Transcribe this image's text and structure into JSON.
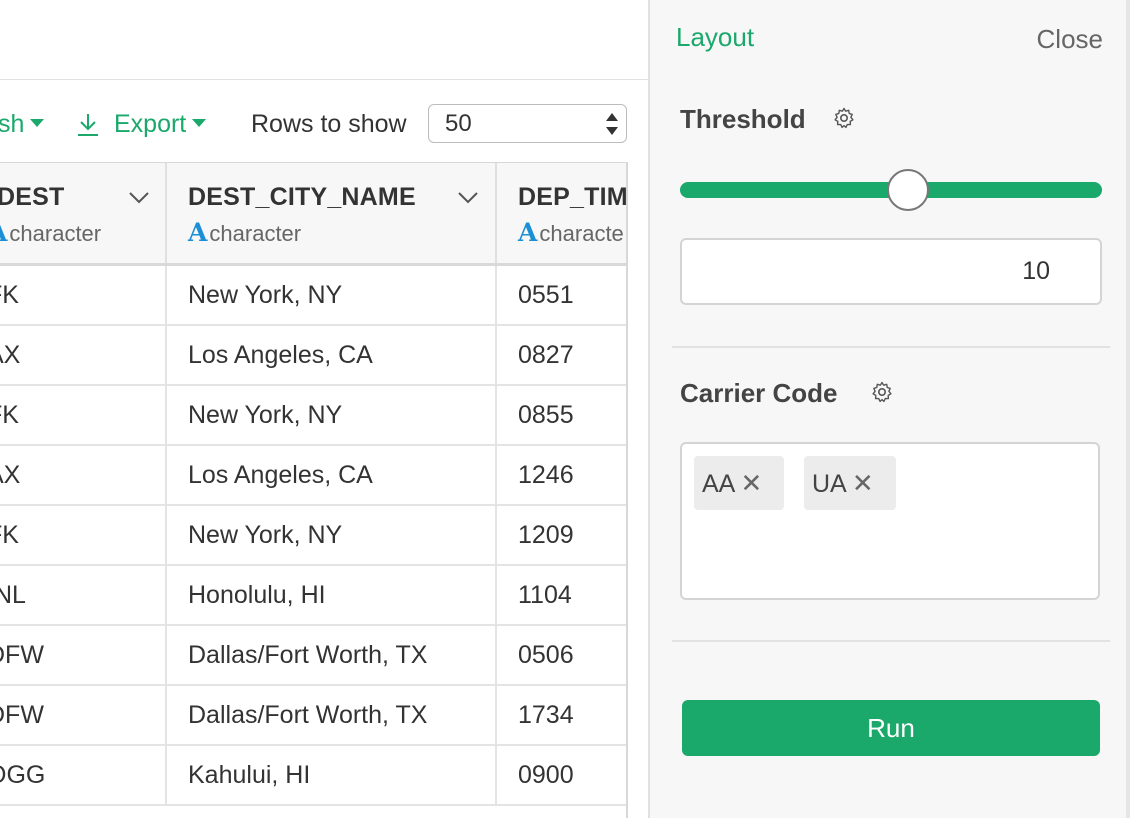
{
  "toolbar": {
    "publish_label": "sh",
    "export_label": "Export",
    "rows_label": "Rows to show",
    "rows_value": "50"
  },
  "columns": [
    {
      "name": "DEST",
      "type": "character"
    },
    {
      "name": "DEST_CITY_NAME",
      "type": "character"
    },
    {
      "name": "DEP_TIM",
      "type": "characte"
    }
  ],
  "type_glyph": "A",
  "rows": [
    [
      "FK",
      "New York, NY",
      "0551"
    ],
    [
      "AX",
      "Los Angeles, CA",
      "0827"
    ],
    [
      "FK",
      "New York, NY",
      "0855"
    ],
    [
      "AX",
      "Los Angeles, CA",
      "1246"
    ],
    [
      "FK",
      "New York, NY",
      "1209"
    ],
    [
      "INL",
      "Honolulu, HI",
      "1104"
    ],
    [
      "DFW",
      "Dallas/Fort Worth, TX",
      "0506"
    ],
    [
      "DFW",
      "Dallas/Fort Worth, TX",
      "1734"
    ],
    [
      "OGG",
      "Kahului, HI",
      "0900"
    ]
  ],
  "panel": {
    "title": "Layout",
    "close_label": "Close",
    "threshold": {
      "label": "Threshold",
      "value": "10",
      "slider_fraction": 0.54
    },
    "carrier": {
      "label": "Carrier Code",
      "tags": [
        "AA",
        "UA"
      ],
      "remove_glyph": "✕"
    },
    "run_label": "Run"
  },
  "colors": {
    "accent": "#1aa86b",
    "type_icon": "#1b8fd6"
  }
}
